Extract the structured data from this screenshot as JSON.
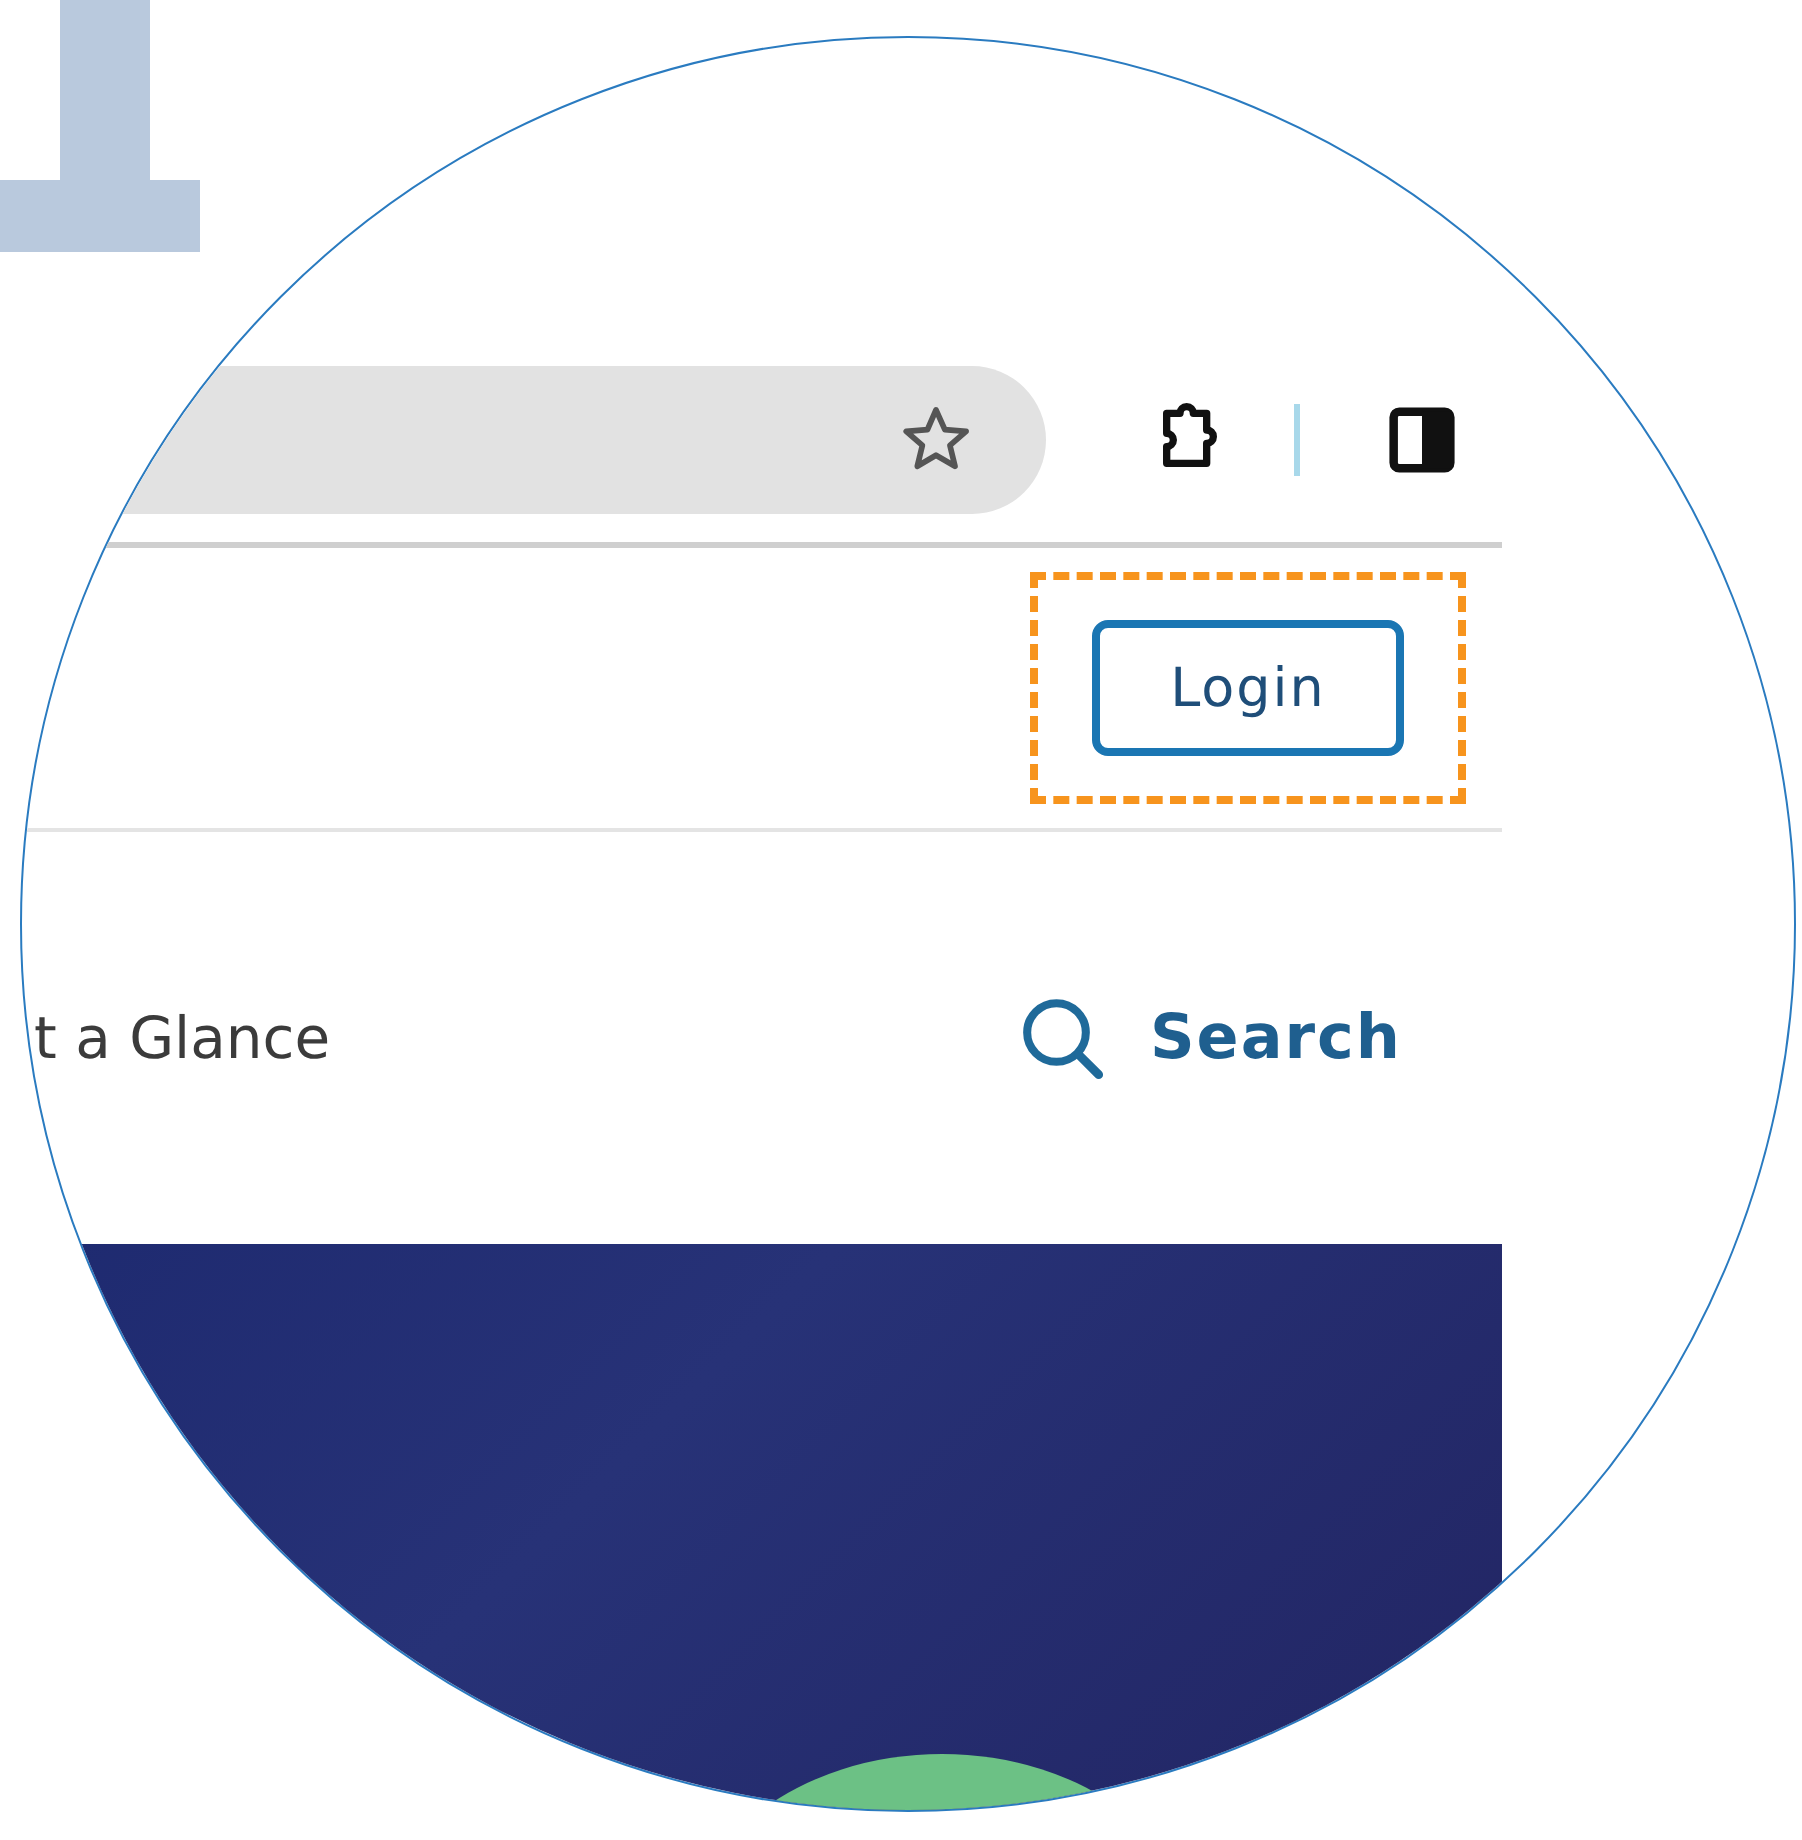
{
  "browser_toolbar": {
    "bookmark_starred": false
  },
  "header": {
    "login_button": "Login",
    "login_highlighted": true
  },
  "nav": {
    "link": "t a Glance",
    "search": "Search"
  }
}
